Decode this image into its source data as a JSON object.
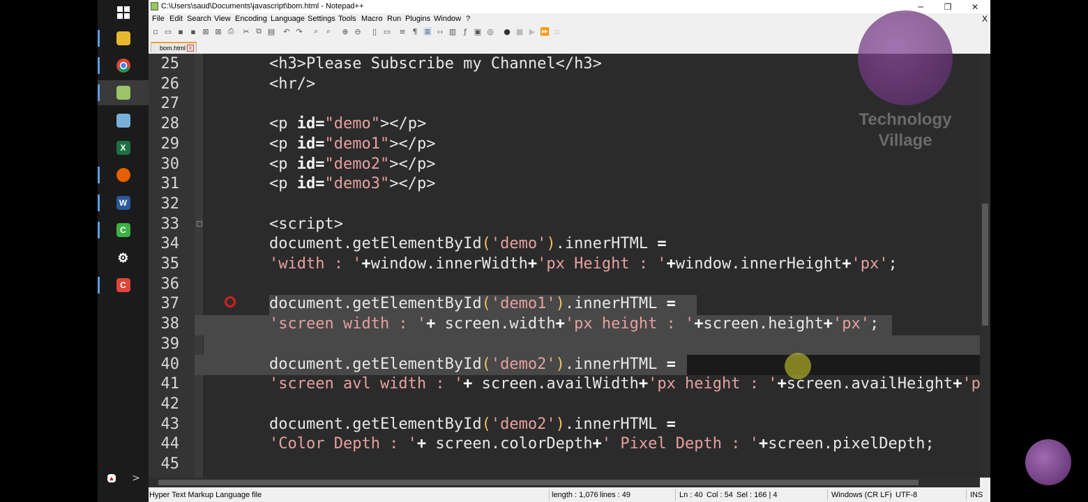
{
  "window": {
    "title": "C:\\Users\\saud\\Documents\\javascript\\bom.html - Notepad++",
    "controls": {
      "minimize": "─",
      "restore": "❐",
      "close": "✕"
    }
  },
  "menu": {
    "items": [
      "File",
      "Edit",
      "Search",
      "View",
      "Encoding",
      "Language",
      "Settings",
      "Tools",
      "Macro",
      "Run",
      "Plugins",
      "Window",
      "?"
    ],
    "close_doc": "X"
  },
  "tabs": [
    {
      "label": "bom.html",
      "close": "x"
    }
  ],
  "editor": {
    "lines": [
      {
        "n": "25",
        "code": "<h3>Please Subscribe my Channel</h3>"
      },
      {
        "n": "26",
        "code": "<hr/>"
      },
      {
        "n": "27",
        "code": ""
      },
      {
        "n": "28",
        "code": "<p id=\"demo\"></p>"
      },
      {
        "n": "29",
        "code": "<p id=\"demo1\"></p>"
      },
      {
        "n": "30",
        "code": "<p id=\"demo2\"></p>"
      },
      {
        "n": "31",
        "code": "<p id=\"demo3\"></p>"
      },
      {
        "n": "32",
        "code": ""
      },
      {
        "n": "33",
        "code": "<script>"
      },
      {
        "n": "34",
        "code": "document.getElementById('demo').innerHTML ="
      },
      {
        "n": "35",
        "code": "'width : '+window.innerWidth+'px Height : '+window.innerHeight+'px';"
      },
      {
        "n": "36",
        "code": ""
      },
      {
        "n": "37",
        "code": "document.getElementById('demo1').innerHTML ="
      },
      {
        "n": "38",
        "code": "'screen width : '+ screen.width+'px height : '+screen.height+'px';"
      },
      {
        "n": "39",
        "code": ""
      },
      {
        "n": "40",
        "code": "document.getElementById('demo2').innerHTML ="
      },
      {
        "n": "41",
        "code": "'screen avl width : '+ screen.availWidth+'px height : '+screen.availHeight+'p"
      },
      {
        "n": "42",
        "code": ""
      },
      {
        "n": "43",
        "code": "document.getElementById('demo2').innerHTML ="
      },
      {
        "n": "44",
        "code": "'Color Depth : '+ screen.colorDepth+' Pixel Depth : '+screen.pixelDepth;"
      },
      {
        "n": "45",
        "code": ""
      }
    ]
  },
  "watermark": {
    "line1": "Technology",
    "line2": "Village"
  },
  "status": {
    "file_type": "Hyper Text Markup Language file",
    "length": "length : 1,076",
    "lines": "lines : 49",
    "ln": "Ln : 40",
    "col": "Col : 54",
    "sel": "Sel : 166 | 4",
    "eol": "Windows (CR LF)",
    "encoding": "UTF-8",
    "mode": "INS"
  },
  "taskbar": {
    "icons": [
      "windows-start-icon",
      "file-explorer-icon",
      "chrome-icon",
      "notepadpp-icon",
      "app-icon",
      "excel-icon",
      "firefox-icon",
      "word-icon",
      "camtasia-icon",
      "settings-icon",
      "camtasia-recorder-icon"
    ],
    "tray": ">"
  },
  "colors": {
    "editor_bg": "#2b2b2b",
    "selection": "#484848",
    "string": "#e7a0a0",
    "paren": "#f0c060",
    "breakpoint": "#d42020"
  }
}
